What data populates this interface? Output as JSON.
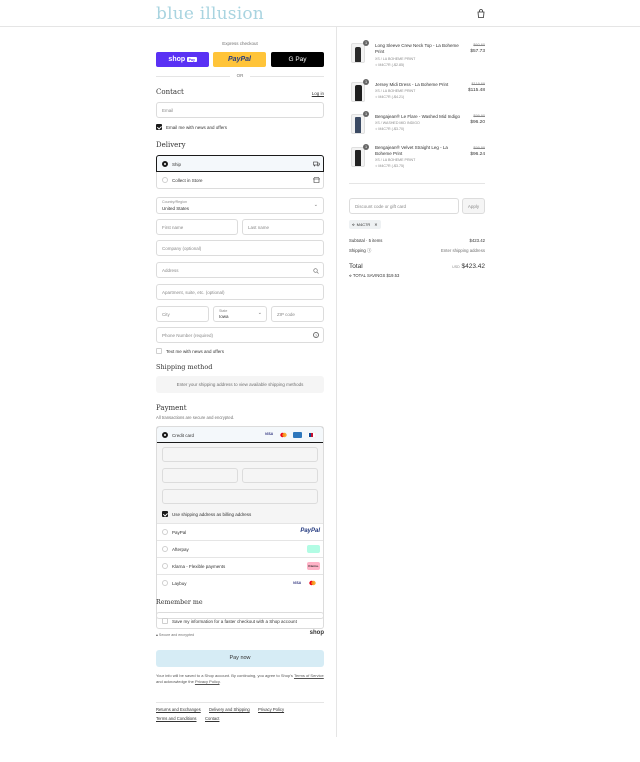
{
  "brand": {
    "logo_text": "blue illusion"
  },
  "express": {
    "label": "Express checkout",
    "shop_pay": "shop",
    "shop_pay_badge": "Pay",
    "paypal": "PayPal",
    "gpay": "G Pay",
    "or": "OR"
  },
  "contact": {
    "heading": "Contact",
    "login": "Log in",
    "email_placeholder": "Email",
    "newsletter": "Email me with news and offers"
  },
  "delivery": {
    "heading": "Delivery",
    "option_ship": "Ship",
    "option_collect": "Collect in Store",
    "country_label": "Country/Region",
    "country_value": "United States",
    "first_name": "First name",
    "last_name": "Last name",
    "company": "Company (optional)",
    "address": "Address",
    "apartment": "Apartment, suite, etc. (optional)",
    "city": "City",
    "state_label": "State",
    "state_value": "Iowa",
    "zip": "ZIP code",
    "phone": "Phone Number (required)",
    "sms": "Text me with news and offers"
  },
  "shipping_method": {
    "heading": "Shipping method",
    "message": "Enter your shipping address to view available shipping methods"
  },
  "payment": {
    "heading": "Payment",
    "subtext": "All transactions are secure and encrypted.",
    "credit_card": "Credit card",
    "billing_same": "Use shipping address as billing address",
    "paypal": "PayPal",
    "afterpay": "Afterpay",
    "klarna": "Klarna - Flexible payments",
    "laybuy": "Laybuy",
    "card_visa": "VISA",
    "klarna_badge": "Klarna."
  },
  "remember": {
    "heading": "Remember me",
    "save_info": "Save my information for a faster checkout with a Shop account",
    "secure": "Secure and encrypted",
    "shop": "shop"
  },
  "pay_now": "Pay now",
  "legal": {
    "line1": "Your info will be saved to a Shop account. By continuing, you agree to Shop's",
    "tos": "Terms of Service",
    "and_ack": "and acknowledge the",
    "privacy": "Privacy Policy",
    "period": "."
  },
  "footer_links": [
    "Returns and Exchanges",
    "Delivery and Shipping",
    "Privacy Policy",
    "Terms and Conditions",
    "Contact"
  ],
  "cart": {
    "items": [
      {
        "qty": "1",
        "title": "Long Sleeve Crew Neck Top - La Boheme Print",
        "variant": "XS / LA BOHEME PRINT",
        "discount": "M4C7R (-$2.85)",
        "original": "$60.60",
        "price": "$57.73"
      },
      {
        "qty": "1",
        "title": "Jersey Midi Dress - La Boheme Print",
        "variant": "XS / LA BOHEME PRINT",
        "discount": "M4C7R (-$4.21)",
        "original": "$119.69",
        "price": "$115.48"
      },
      {
        "qty": "1",
        "title": "Bengajean® Le Flare - Washed Mid Indigo",
        "variant": "XS / WASHED MID INDIGO",
        "discount": "M4C7R (-$3.70)",
        "original": "$99.90",
        "price": "$96.20"
      },
      {
        "qty": "1",
        "title": "Bengajean® Velvet Straight Leg - La Boheme Print",
        "variant": "XS / LA BOHEME PRINT",
        "discount": "M4C7R (-$3.75)",
        "original": "$99.99",
        "price": "$96.24"
      }
    ],
    "discount_placeholder": "Discount code or gift card",
    "apply": "Apply",
    "applied_code": "M4C7R",
    "subtotal_label": "Subtotal · 5 items",
    "subtotal_value": "$423.42",
    "shipping_label": "Shipping",
    "shipping_value": "Enter shipping address",
    "total_label": "Total",
    "currency": "USD",
    "total_value": "$423.42",
    "savings": "TOTAL SAVINGS $19.53"
  },
  "colors": {
    "shop_pay": "#5a31f4",
    "paypal": "#ffc439",
    "gpay": "#000000",
    "accent_logo": "#a9d4e0",
    "pay_now_bg": "#d6ecf5"
  }
}
